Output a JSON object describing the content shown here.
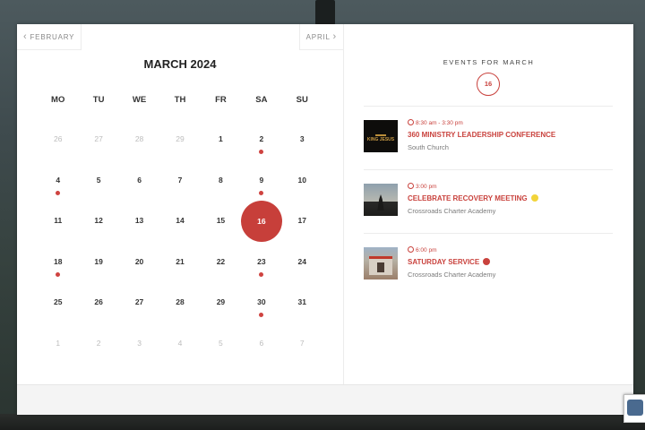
{
  "calendar": {
    "prev_label": "FEBRUARY",
    "next_label": "APRIL",
    "month_title": "MARCH 2024",
    "weekdays": [
      "MO",
      "TU",
      "WE",
      "TH",
      "FR",
      "SA",
      "SU"
    ],
    "days": [
      {
        "n": "26",
        "muted": true
      },
      {
        "n": "27",
        "muted": true
      },
      {
        "n": "28",
        "muted": true
      },
      {
        "n": "29",
        "muted": true
      },
      {
        "n": "1"
      },
      {
        "n": "2",
        "dot": true
      },
      {
        "n": "3"
      },
      {
        "n": "4",
        "dot": true
      },
      {
        "n": "5"
      },
      {
        "n": "6"
      },
      {
        "n": "7"
      },
      {
        "n": "8"
      },
      {
        "n": "9",
        "dot": true
      },
      {
        "n": "10"
      },
      {
        "n": "11"
      },
      {
        "n": "12"
      },
      {
        "n": "13"
      },
      {
        "n": "14"
      },
      {
        "n": "15"
      },
      {
        "n": "16",
        "selected": true
      },
      {
        "n": "17"
      },
      {
        "n": "18",
        "dot": true
      },
      {
        "n": "19"
      },
      {
        "n": "20"
      },
      {
        "n": "21"
      },
      {
        "n": "22"
      },
      {
        "n": "23",
        "dot": true
      },
      {
        "n": "24"
      },
      {
        "n": "25"
      },
      {
        "n": "26"
      },
      {
        "n": "27"
      },
      {
        "n": "28"
      },
      {
        "n": "29"
      },
      {
        "n": "30",
        "dot": true
      },
      {
        "n": "31"
      },
      {
        "n": "1",
        "muted": true
      },
      {
        "n": "2",
        "muted": true
      },
      {
        "n": "3",
        "muted": true
      },
      {
        "n": "4",
        "muted": true
      },
      {
        "n": "5",
        "muted": true
      },
      {
        "n": "6",
        "muted": true
      },
      {
        "n": "7",
        "muted": true
      }
    ]
  },
  "events_panel": {
    "heading": "EVENTS FOR MARCH",
    "selected_day": "16",
    "items": [
      {
        "time": "8:30 am - 3:30 pm",
        "title": "360 MINISTRY LEADERSHIP CONFERENCE",
        "location": "South Church",
        "thumb_text": "KING JESUS",
        "badge_color": ""
      },
      {
        "time": "3:00 pm",
        "title": "CELEBRATE RECOVERY MEETING",
        "location": "Crossroads Charter Academy",
        "badge_color": "#f2d43a"
      },
      {
        "time": "6:00 pm",
        "title": "SATURDAY SERVICE",
        "location": "Crossroads Charter Academy",
        "badge_color": "#c9423d"
      }
    ]
  },
  "colors": {
    "accent": "#c9423d",
    "selected_day": "#c73f3a"
  }
}
